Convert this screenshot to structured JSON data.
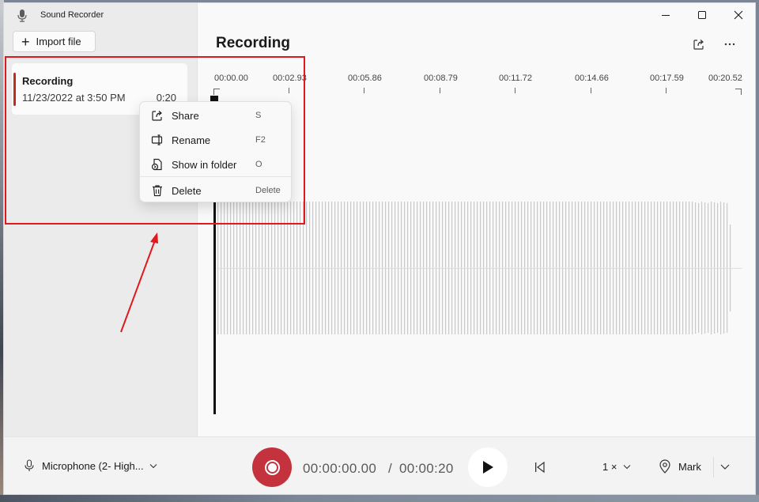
{
  "app": {
    "title": "Sound Recorder",
    "icon": "microphone-icon"
  },
  "sidebar": {
    "import_label": "Import file",
    "recordings": [
      {
        "name": "Recording",
        "date": "11/23/2022 at 3:50 PM",
        "duration": "0:20"
      }
    ]
  },
  "main": {
    "title": "Recording",
    "timeline": [
      "00:00.00",
      "00:02.93",
      "00:05.86",
      "00:08.79",
      "00:11.72",
      "00:14.66",
      "00:17.59",
      "00:20.52"
    ]
  },
  "context_menu": {
    "items": [
      {
        "label": "Share",
        "shortcut": "S",
        "icon": "share-icon"
      },
      {
        "label": "Rename",
        "shortcut": "F2",
        "icon": "rename-icon"
      },
      {
        "label": "Show in folder",
        "shortcut": "O",
        "icon": "folder-icon"
      },
      {
        "label": "Delete",
        "shortcut": "Delete",
        "icon": "trash-icon"
      }
    ]
  },
  "bottom": {
    "microphone_label": "Microphone (2- High...",
    "current_time": "00:00:00.00",
    "separator": "/",
    "total_time": "00:00:20",
    "speed_label": "1 ×",
    "mark_label": "Mark"
  },
  "colors": {
    "accent": "#c42b1c",
    "record_button": "#c4323e",
    "annotation": "#e0191e"
  }
}
